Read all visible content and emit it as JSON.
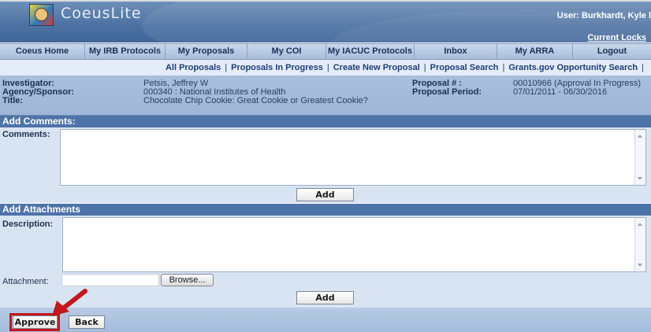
{
  "header": {
    "app_name": "CoeusLite",
    "user_text": "User: Burkhardt, Kyle l",
    "current_locks": "Current Locks"
  },
  "nav": {
    "tabs": [
      "Coeus Home",
      "My IRB Protocols",
      "My Proposals",
      "My COI",
      "My IACUC Protocols",
      "Inbox",
      "My ARRA",
      "Logout"
    ]
  },
  "subnav": {
    "links": [
      "All Proposals",
      "Proposals In Progress",
      "Create New Proposal",
      "Proposal Search",
      "Grants.gov Opportunity Search"
    ]
  },
  "info": {
    "investigator_label": "Investigator:",
    "investigator_value": "Petsis, Jeffrey W",
    "sponsor_label": "Agency/Sponsor:",
    "sponsor_value": "000340 : National Institutes of Health",
    "title_label": "Title:",
    "title_value": "Chocolate Chip Cookie: Great Cookie or Greatest Cookie?",
    "proposal_num_label": "Proposal # :",
    "proposal_num_value": "00010966 (Approval In Progress)",
    "proposal_period_label": "Proposal Period:",
    "proposal_period_value": "07/01/2011 - 06/30/2016"
  },
  "comments": {
    "section_title": "Add Comments:",
    "field_label": "Comments:",
    "value": "",
    "add_label": "Add"
  },
  "attachments": {
    "section_title": "Add Attachments",
    "description_label": "Description:",
    "description_value": "",
    "attachment_label": "Attachment:",
    "browse_label": "Browse...",
    "add_label": "Add"
  },
  "footer": {
    "approve_label": "Approve",
    "back_label": "Back"
  },
  "colors": {
    "highlight": "#c4161c",
    "section_bar": "#4d74a8"
  }
}
